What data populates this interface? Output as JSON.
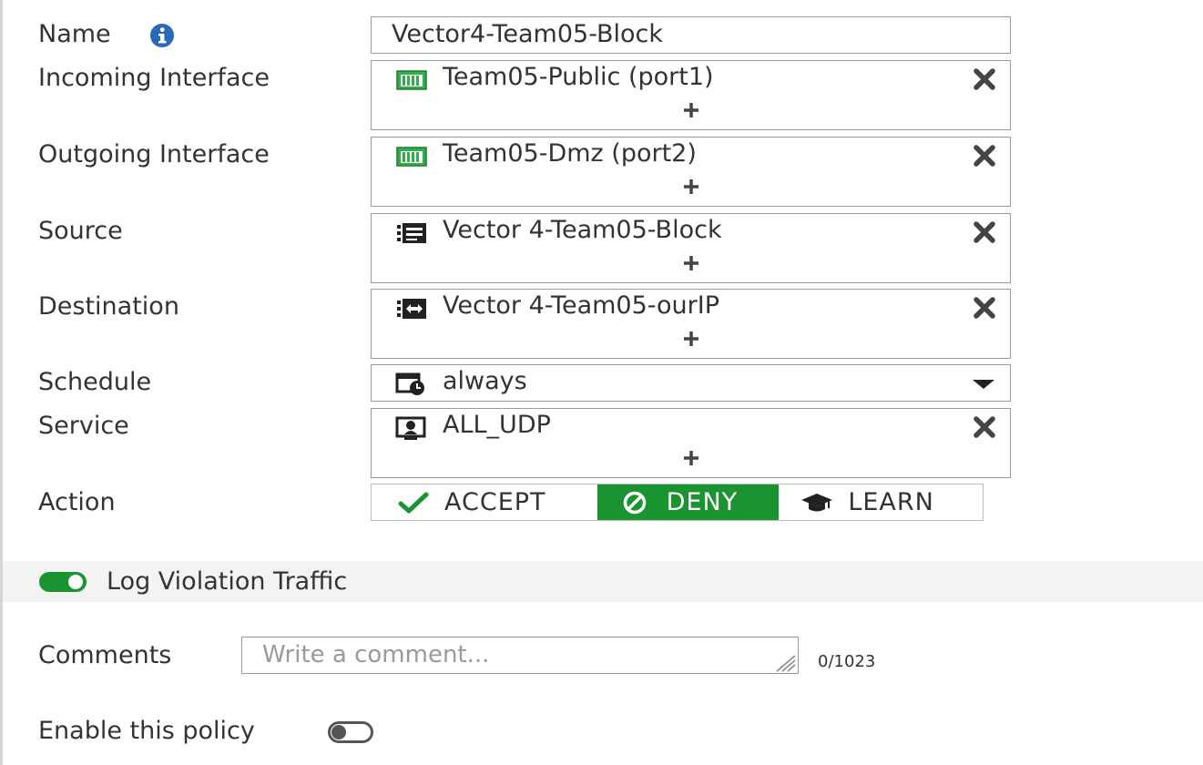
{
  "form": {
    "name": {
      "label": "Name",
      "value": "Vector4-Team05-Block",
      "info_icon": "info-icon"
    },
    "incoming_interface": {
      "label": "Incoming Interface",
      "entries": [
        {
          "text": "Team05-Public (port1)",
          "icon": "network-port-icon"
        }
      ]
    },
    "outgoing_interface": {
      "label": "Outgoing Interface",
      "entries": [
        {
          "text": "Team05-Dmz (port2)",
          "icon": "network-port-icon"
        }
      ]
    },
    "source": {
      "label": "Source",
      "entries": [
        {
          "text": "Vector 4-Team05-Block",
          "icon": "address-icon"
        }
      ]
    },
    "destination": {
      "label": "Destination",
      "entries": [
        {
          "text": "Vector 4-Team05-ourIP",
          "icon": "address-range-icon"
        }
      ]
    },
    "schedule": {
      "label": "Schedule",
      "value": "always",
      "icon": "schedule-icon"
    },
    "service": {
      "label": "Service",
      "entries": [
        {
          "text": "ALL_UDP",
          "icon": "service-icon"
        }
      ]
    },
    "action": {
      "label": "Action",
      "options": [
        {
          "label": "ACCEPT",
          "icon": "checkmark-icon"
        },
        {
          "label": "DENY",
          "icon": "deny-icon"
        },
        {
          "label": "LEARN",
          "icon": "graduation-cap-icon"
        }
      ],
      "selected": "DENY"
    }
  },
  "log_violation": {
    "label": "Log Violation Traffic",
    "enabled": true
  },
  "comments": {
    "label": "Comments",
    "placeholder": "Write a comment...",
    "value": "",
    "counter": "0/1023"
  },
  "enable_policy": {
    "label": "Enable this policy",
    "enabled": false
  },
  "colors": {
    "accent_green": "#1a9431",
    "port_icon_green": "#2fae4a",
    "text": "#333333",
    "border": "#9a9a9a"
  }
}
